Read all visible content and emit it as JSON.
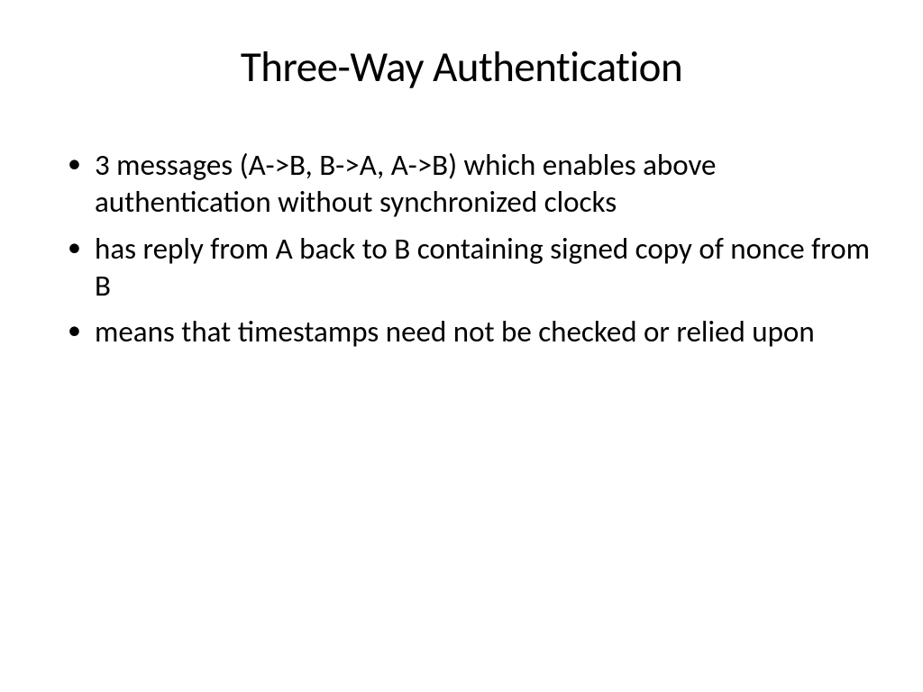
{
  "slide": {
    "title": "Three-Way Authentication",
    "bullets": [
      "3 messages (A->B, B->A, A->B) which enables above authentication without synchronized clocks",
      "has reply from A back to B containing signed copy of nonce from B",
      "means that timestamps need not be checked or relied upon"
    ]
  }
}
